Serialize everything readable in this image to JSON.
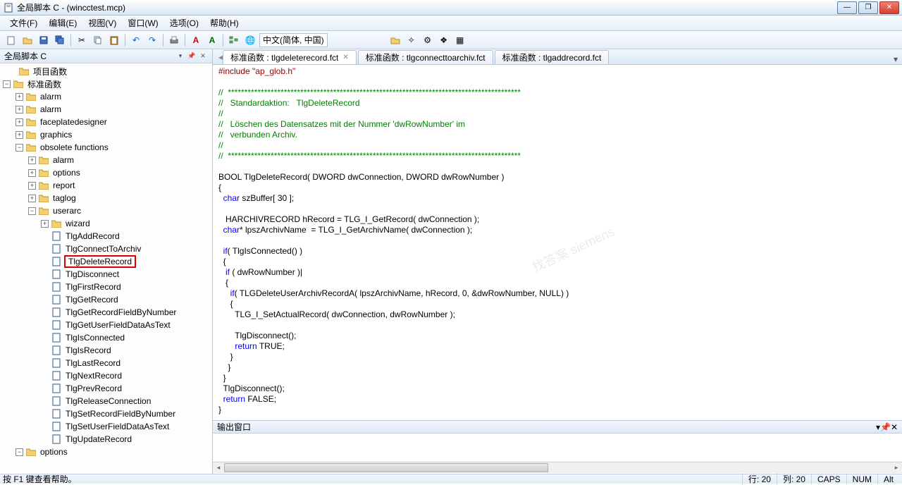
{
  "window": {
    "title": "全局脚本 C - (wincctest.mcp)",
    "min": "—",
    "max": "❐",
    "close": "✕"
  },
  "menu": {
    "file": "文件(F)",
    "edit": "编辑(E)",
    "view": "视图(V)",
    "window": "窗口(W)",
    "options": "选项(O)",
    "help": "帮助(H)"
  },
  "toolbar": {
    "language": "中文(简体, 中国)"
  },
  "side": {
    "title": "全局脚本 C",
    "projectFunctions": "项目函数",
    "standardFunctions": "标准函数",
    "alarm1": "alarm",
    "alarm2": "alarm",
    "faceplate": "faceplatedesigner",
    "graphics": "graphics",
    "obsolete": "obsolete functions",
    "obs_alarm": "alarm",
    "obs_options": "options",
    "obs_report": "report",
    "obs_taglog": "taglog",
    "obs_userarc": "userarc",
    "wizard": "wizard",
    "fn_add": "TlgAddRecord",
    "fn_conn": "TlgConnectToArchiv",
    "fn_del": "TlgDeleteRecord",
    "fn_disc": "TlgDisconnect",
    "fn_first": "TlgFirstRecord",
    "fn_get": "TlgGetRecord",
    "fn_getfield": "TlgGetRecordFieldByNumber",
    "fn_getuser": "TlgGetUserFieldDataAsText",
    "fn_isconn": "TlgIsConnected",
    "fn_isrec": "TlgIsRecord",
    "fn_last": "TlgLastRecord",
    "fn_next": "TlgNextRecord",
    "fn_prev": "TlgPrevRecord",
    "fn_release": "TlgReleaseConnection",
    "fn_setfield": "TlgSetRecordFieldByNumber",
    "fn_setuser": "TlgSetUserFieldDataAsText",
    "fn_update": "TlgUpdateRecord",
    "options": "options"
  },
  "tabs": {
    "t1": "标准函数 : tlgdeleterecord.fct",
    "t2": "标准函数 : tlgconnecttoarchiv.fct",
    "t3": "标准函数 : tlgaddrecord.fct"
  },
  "code": {
    "l1a": "#include ",
    "l1b": "\"ap_glob.h\"",
    "l2": "//  *****************************************************************************************",
    "l3": "//   Standardaktion:   TlgDeleteRecord",
    "l4": "//",
    "l5": "//   Löschen des Datensatzes mit der Nummer 'dwRowNumber' im",
    "l6": "//   verbunden Archiv.",
    "l7": "//",
    "l8": "//  *****************************************************************************************",
    "l9a": "BOOL TlgDeleteRecord( DWORD dwConnection, DWORD dwRowNumber )",
    "l10": "{",
    "l11a": "  ",
    "l11b": "char",
    "l11c": " szBuffer[ 30 ];",
    "l12a": "   HARCHIVRECORD hRecord = TLG_I_GetRecord( dwConnection );",
    "l13a": "  ",
    "l13b": "char",
    "l13c": "* lpszArchivName  = TLG_I_GetArchivName( dwConnection );",
    "l14a": "  ",
    "l14b": "if",
    "l14c": "( TlgIsConnected() )",
    "l15": "  {",
    "l16a": "   ",
    "l16b": "if",
    "l16c": " ( dwRowNumber )|",
    "l17": "   {",
    "l18a": "     ",
    "l18b": "if",
    "l18c": "( TLGDeleteUserArchivRecordA( lpszArchivName, hRecord, 0, &dwRowNumber, NULL) )",
    "l19": "     {",
    "l20": "       TLG_I_SetActualRecord( dwConnection, dwRowNumber );",
    "l21": "",
    "l22": "       TlgDisconnect();",
    "l23a": "       ",
    "l23b": "return",
    "l23c": " TRUE;",
    "l24": "     }",
    "l25": "    }",
    "l26": "  }",
    "l27": "  TlgDisconnect();",
    "l28a": "  ",
    "l28b": "return",
    "l28c": " FALSE;",
    "l29": "}"
  },
  "output": {
    "title": "输出窗口"
  },
  "status": {
    "help": "按 F1 键查看帮助。",
    "line": "行:     20",
    "col": "列:     20",
    "caps": "CAPS",
    "num": "NUM",
    "alt": "Alt"
  }
}
